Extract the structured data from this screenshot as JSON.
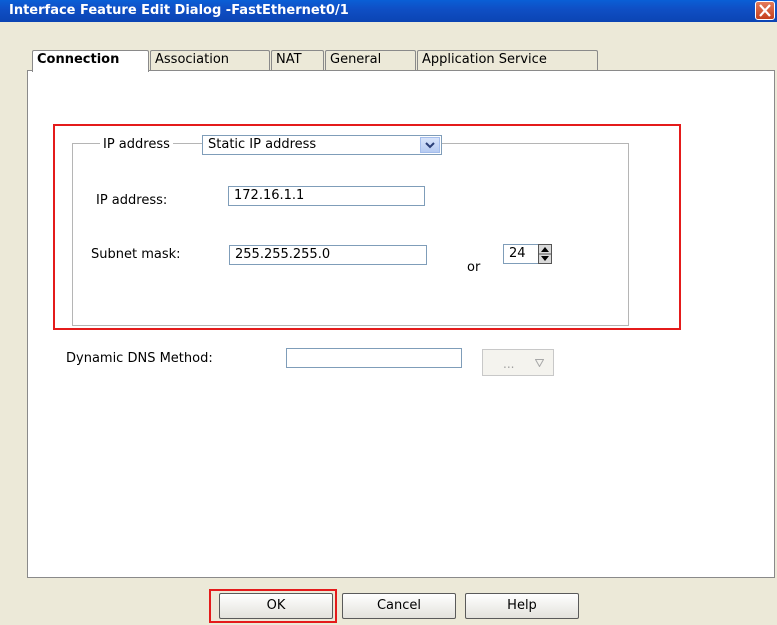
{
  "window": {
    "title": "Interface Feature Edit Dialog -FastEthernet0/1"
  },
  "tabs": [
    {
      "label": "Connection",
      "active": true
    },
    {
      "label": "Association",
      "active": false
    },
    {
      "label": "NAT",
      "active": false
    },
    {
      "label": "General",
      "active": false
    },
    {
      "label": "Application Service",
      "active": false
    }
  ],
  "connection": {
    "ip_mode_label": "IP address",
    "ip_mode_value": "Static IP address",
    "ip_address_label": "IP address:",
    "ip_address_value": "172.16.1.1",
    "subnet_mask_label": "Subnet mask:",
    "subnet_mask_value": "255.255.255.0",
    "or_label": "or",
    "prefix_length_value": "24",
    "dynamic_dns_label": "Dynamic DNS Method:",
    "dynamic_dns_value": "",
    "dynamic_dns_button_label": "..."
  },
  "buttons": {
    "ok": "OK",
    "cancel": "Cancel",
    "help": "Help"
  },
  "colors": {
    "highlight": "#e41b1b",
    "titlebar": "#0b50c8"
  }
}
